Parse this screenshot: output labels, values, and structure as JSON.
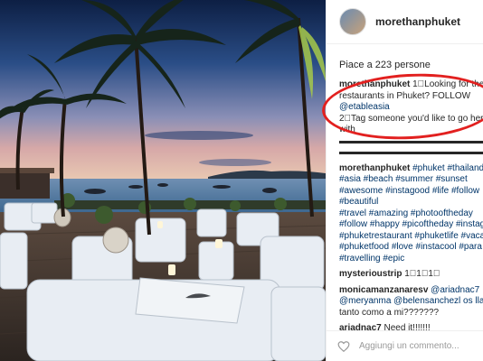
{
  "post": {
    "username": "morethanphuket",
    "likes_text": "Piace a 223 persone"
  },
  "caption": {
    "user": "morethanphuket",
    "line1": " 1⃣Looking for the",
    "line2": "restaurants in Phuket? FOLLOW",
    "mention": "@etableasia",
    "line4": "2⃣Tag someone you'd like to go here",
    "line5": "with",
    "dashes1": "▬▬▬▬▬▬▬▬▬▬▬▬▬▬▬▬▬▬",
    "dashes2": "▬▬▬▬▬▬▬▬▬▬▬▬▬▬▬▬▬▬"
  },
  "hashtags": {
    "user": "morethanphuket",
    "line1": " #phuket #thailand",
    "line2": "#asia #beach #summer #sunset",
    "line3": "#awesome #instagood #life #follow",
    "line4": "#beautiful",
    "line5": "#travel #amazing #photooftheday",
    "line6": "#follow #happy #picoftheday #instag",
    "line7": "#phuketrestaurant #phuketlife #vaca",
    "line8": "#phuketfood #love #instacool #para",
    "line9": "#travelling #epic"
  },
  "comments": [
    {
      "user": "mysterioustrip",
      "text": " 1⃣1⃣1⃣"
    },
    {
      "user": "monicamanzanaresv",
      "text": " @ariadnac7",
      "line2": "@meryanma @belensanchezl os llam",
      "line3": "tanto como a mi???????"
    },
    {
      "user": "ariadnac7",
      "text": " Need it!!!!!!!"
    }
  ],
  "footer": {
    "placeholder": "Aggiungi un commento...",
    "heart_icon": "heart-icon"
  },
  "colors": {
    "highlight": "#e2201f",
    "link": "#003569",
    "muted": "#999999"
  }
}
